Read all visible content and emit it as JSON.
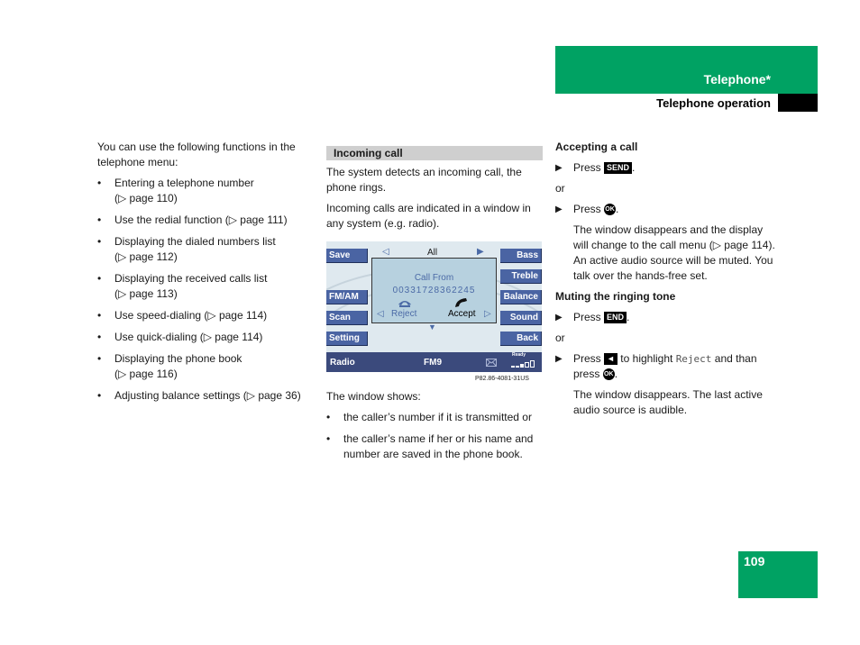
{
  "header": {
    "section_title": "Telephone*",
    "subsection_title": "Telephone operation"
  },
  "page_number": "109",
  "column1": {
    "intro": "You can use the following functions in the telephone menu:",
    "items": [
      {
        "text": "Entering a telephone number",
        "ref": "(▷ page 110)"
      },
      {
        "text": "Use the redial function (▷ page 111)",
        "ref": ""
      },
      {
        "text": "Displaying the dialed numbers list",
        "ref": "(▷ page 112)"
      },
      {
        "text": "Displaying the received calls list",
        "ref": "(▷ page 113)"
      },
      {
        "text": "Use speed-dialing (▷ page 114)",
        "ref": ""
      },
      {
        "text": "Use quick-dialing (▷ page 114)",
        "ref": ""
      },
      {
        "text": "Displaying the phone book",
        "ref": "(▷ page 116)"
      },
      {
        "text": "Adjusting balance settings (▷ page 36)",
        "ref": ""
      }
    ]
  },
  "column2": {
    "section_heading": "Incoming call",
    "para1": "The system detects an incoming call, the phone rings.",
    "para2": "Incoming calls are indicated in a window in any system (e.g. radio).",
    "window_intro": "The window shows:",
    "bullets": [
      "the caller’s number if it is transmitted or",
      "the caller’s name if her or his name and number are saved in the phone book."
    ],
    "figure_caption": "P82.86-4081-31US"
  },
  "screen": {
    "left_buttons": [
      "Save",
      "FM/AM",
      "Scan",
      "Setting"
    ],
    "right_buttons": [
      "Bass",
      "Treble",
      "Balance",
      "Sound",
      "Back"
    ],
    "top_left_arrow": "◁",
    "top_label": "All",
    "top_right_arrow": "▶",
    "popup_title": "Call From",
    "popup_number": "00331728362245",
    "reject_label": "Reject",
    "accept_label": "Accept",
    "reject_arrow": "◁",
    "accept_arrow": "▷",
    "down_arrow": "▼",
    "status_source": "Radio",
    "status_station": "FM9",
    "status_ready": "Ready",
    "colors": {
      "button_bg": "#4a64a3",
      "popup_bg": "#b7d1df",
      "status_bg": "#3b4a7c",
      "screen_bg": "#dfe9ef"
    }
  },
  "column3": {
    "accept_heading": "Accepting a call",
    "press": "Press",
    "send_key": "SEND",
    "or": "or",
    "ok_key": "OK",
    "accept_result": "The window disappears and the display will change to the call menu (▷ page 114). An active audio source will be muted. You talk over the hands-free set.",
    "mute_heading": "Muting the ringing tone",
    "end_key": "END",
    "left_key": "◄",
    "to_highlight": "to highlight",
    "reject_word": "Reject",
    "and": "and",
    "than_press": "than press",
    "mute_result": "The window disappears. The last active audio source is audible."
  },
  "colors": {
    "accent_green": "#00a263",
    "section_bar_gray": "#cfcfcf"
  }
}
